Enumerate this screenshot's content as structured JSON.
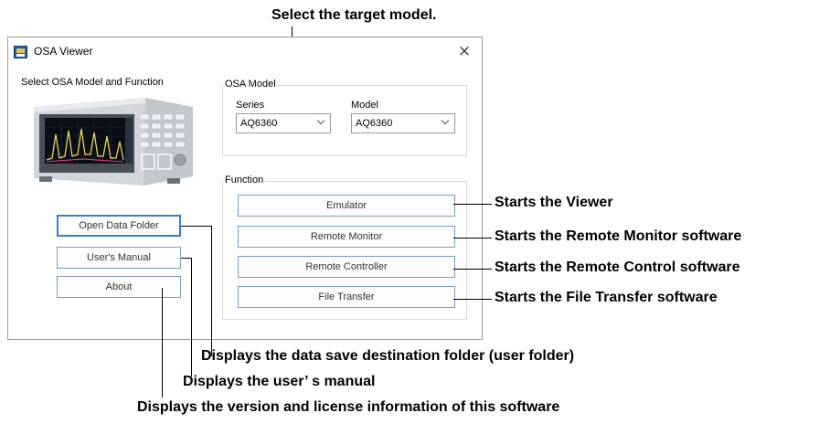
{
  "window": {
    "title": "OSA Viewer",
    "close_glyph": "×",
    "subtitle": "Select OSA Model and Function",
    "app_icon": "osa-viewer-app-icon"
  },
  "left_buttons": {
    "open_data_folder": "Open Data Folder",
    "users_manual": "User's Manual",
    "about": "About"
  },
  "osa_model": {
    "group_title": "OSA Model",
    "series_label": "Series",
    "series_value": "AQ6360",
    "model_label": "Model",
    "model_value": "AQ6360"
  },
  "function": {
    "group_title": "Function",
    "emulator": "Emulator",
    "remote_monitor": "Remote Monitor",
    "remote_controller": "Remote Controller",
    "file_transfer": "File Transfer"
  },
  "annotations": {
    "select_model": "Select the target model.",
    "starts_viewer": "Starts the Viewer",
    "starts_remote_monitor": "Starts the Remote Monitor software",
    "starts_remote_control": "Starts the Remote Control software",
    "starts_file_transfer": "Starts the File Transfer software",
    "displays_data_folder": "Displays the data save destination folder (user folder)",
    "displays_manual": "Displays the user’ s manual",
    "displays_version": "Displays the version and license information of this software"
  }
}
